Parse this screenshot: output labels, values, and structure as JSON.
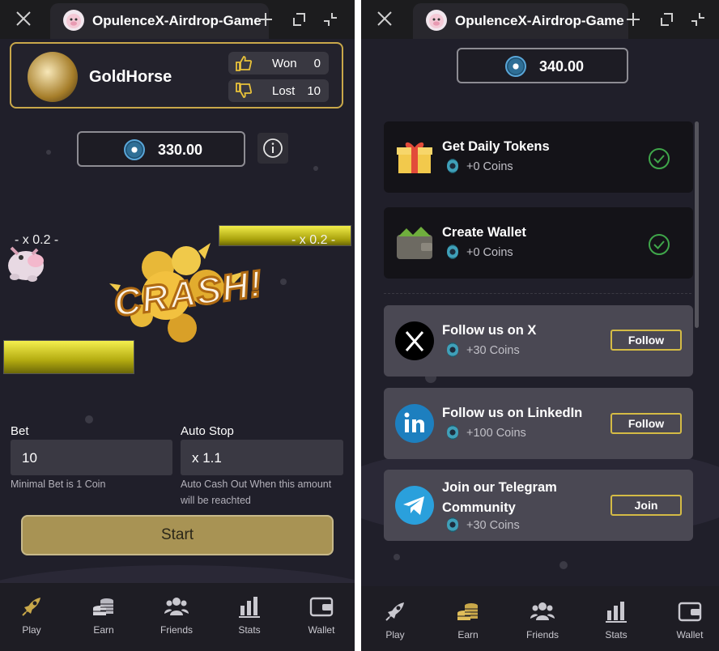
{
  "left": {
    "tab_title": "OpulenceX-Airdrop-Game",
    "player_name": "GoldHorse",
    "won_label": "Won",
    "won_value": "0",
    "lost_label": "Lost",
    "lost_value": "10",
    "balance": "330.00",
    "multiplier_left": "- x 0.2 -",
    "multiplier_right": "- x 0.2 -",
    "crash_text": "CRASH!",
    "bet_label": "Bet",
    "bet_value": "10",
    "bet_hint": "Minimal Bet is 1 Coin",
    "autostop_label": "Auto Stop",
    "autostop_value": "x 1.1",
    "autostop_hint": "Auto Cash Out When this amount will be reachted",
    "start_label": "Start"
  },
  "right": {
    "tab_title": "OpulenceX-Airdrop-Game",
    "balance": "340.00",
    "tasks": [
      {
        "title": "Get Daily Tokens",
        "reward": "+0 Coins"
      },
      {
        "title": "Create Wallet",
        "reward": "+0 Coins"
      },
      {
        "title": "Follow us on X",
        "reward": "+30 Coins",
        "button": "Follow"
      },
      {
        "title": "Follow us on LinkedIn",
        "reward": "+100 Coins",
        "button": "Follow"
      },
      {
        "title": "Join our Telegram Community",
        "reward": "+30 Coins",
        "button": "Join"
      }
    ]
  },
  "nav": {
    "items": [
      "Play",
      "Earn",
      "Friends",
      "Stats",
      "Wallet"
    ]
  },
  "colors": {
    "accent_gold": "#c9a84a",
    "active_play_left": "#c9a84a",
    "active_earn_right": "#c9a84a",
    "check_green": "#3fa64a",
    "panel_bg": "#201f2a"
  },
  "icons": [
    "close-icon",
    "plus-icon",
    "restore-icon",
    "collapse-icon",
    "coin-icon",
    "info-icon",
    "thumbs-up-icon",
    "thumbs-down-icon",
    "rocket-icon",
    "coins-icon",
    "friends-icon",
    "stats-icon",
    "wallet-icon",
    "gift-icon",
    "x-logo-icon",
    "linkedin-icon",
    "telegram-icon",
    "check-icon"
  ]
}
